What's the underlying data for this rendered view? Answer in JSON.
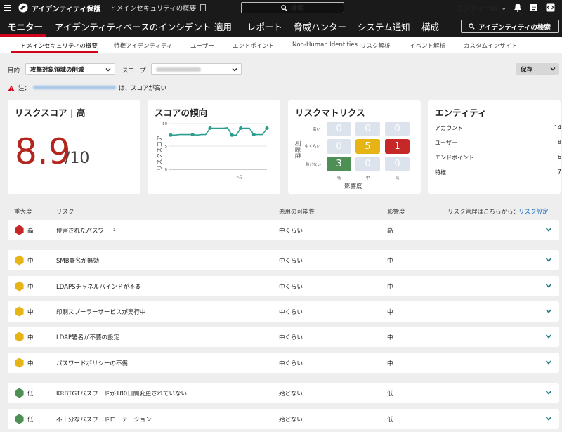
{
  "topbar": {
    "app_title": "アイデンティティ保護",
    "page_title": "ドメインセキュリティの概要",
    "search_label": "検索",
    "customer_label": "カスタマーID"
  },
  "nav": {
    "items": [
      "モニター",
      "アイデンティティベースのインシデント",
      "適用",
      "レポート",
      "脅威ハンター",
      "システム通知",
      "構成"
    ],
    "active_index": 0,
    "identity_search_label": "アイデンティティの検索"
  },
  "subnav": {
    "items": [
      "ドメインセキュリティの概要",
      "特権アイデンティティ",
      "ユーザー",
      "エンドポイント",
      "Non-Human Identities",
      "リスク解析",
      "イベント解析",
      "カスタムインサイト"
    ],
    "active_index": 0
  },
  "filters": {
    "goal_label": "目的",
    "goal_value": "攻撃対象領域の削減",
    "scope_label": "スコープ",
    "save_label": "保存"
  },
  "notice": {
    "prefix": "注：",
    "suffix": "は、スコアが高い"
  },
  "risk_score": {
    "title": "リスクスコア | 高",
    "value": "8.9",
    "denominator": "/10"
  },
  "trend": {
    "title": "スコアの傾向",
    "ylabel": "リスクスコア",
    "y_ticks": [
      "10",
      "5",
      "0"
    ],
    "month_label": "6月",
    "values": [
      7.5,
      7.5,
      7.6,
      7.6,
      7.6,
      7.6,
      7.5,
      7.6,
      7.6,
      9.0,
      9.0,
      9.0,
      9.0,
      9.1,
      7.5,
      7.5,
      9.0,
      9.0,
      9.0,
      7.6,
      7.6,
      7.6,
      9.0
    ],
    "marker_indices": [
      0,
      5,
      9,
      14,
      16,
      19,
      22
    ],
    "ylim": [
      0,
      10
    ],
    "line_color": "#2a9d8f"
  },
  "matrix": {
    "title": "リスクマトリクス",
    "ylabel": "可能性",
    "xlabel": "影響度",
    "row_labels": [
      "高い",
      "中くらい",
      "殆どない"
    ],
    "col_labels": [
      "低",
      "中",
      "高"
    ],
    "cells": [
      [
        {
          "v": "0",
          "c": "empty"
        },
        {
          "v": "0",
          "c": "empty"
        },
        {
          "v": "0",
          "c": "empty"
        }
      ],
      [
        {
          "v": "0",
          "c": "empty"
        },
        {
          "v": "5",
          "c": "yellow"
        },
        {
          "v": "1",
          "c": "red"
        }
      ],
      [
        {
          "v": "3",
          "c": "green"
        },
        {
          "v": "0",
          "c": "empty"
        },
        {
          "v": "0",
          "c": "empty"
        }
      ]
    ]
  },
  "entities": {
    "title": "エンティティ",
    "rows": [
      {
        "label": "アカウント",
        "value": "14"
      },
      {
        "label": "ユーザー",
        "value": "8"
      },
      {
        "label": "エンドポイント",
        "value": "6"
      },
      {
        "label": "特権",
        "value": "7"
      }
    ]
  },
  "table": {
    "headers": {
      "severity": "重大度",
      "risk": "リスク",
      "likelihood": "悪用の可能性",
      "impact": "影響度",
      "manage_prefix": "リスク管理はこちらから：",
      "manage_link": "リスク設定"
    },
    "rows": [
      {
        "severity": "高",
        "color": "#c62828",
        "risk": "侵害されたパスワード",
        "likelihood": "中くらい",
        "impact": "高"
      },
      {
        "severity": "中",
        "color": "#e7b416",
        "risk": "SMB署名が無効",
        "likelihood": "中くらい",
        "impact": "中"
      },
      {
        "severity": "中",
        "color": "#e7b416",
        "risk": "LDAPSチャネルバインドが不要",
        "likelihood": "中くらい",
        "impact": "中"
      },
      {
        "severity": "中",
        "color": "#e7b416",
        "risk": "印刷スプーラーサービスが実行中",
        "likelihood": "中くらい",
        "impact": "中"
      },
      {
        "severity": "中",
        "color": "#e7b416",
        "risk": "LDAP署名が不要の設定",
        "likelihood": "中くらい",
        "impact": "中"
      },
      {
        "severity": "中",
        "color": "#e7b416",
        "risk": "パスワードポリシーの不備",
        "likelihood": "中くらい",
        "impact": "中"
      },
      {
        "severity": "低",
        "color": "#4e8f56",
        "risk": "KRBTGTパスワードが180日間変更されていない",
        "likelihood": "殆どない",
        "impact": "低"
      },
      {
        "severity": "低",
        "color": "#4e8f56",
        "risk": "不十分なパスワードローテーション",
        "likelihood": "殆どない",
        "impact": "低"
      }
    ]
  }
}
